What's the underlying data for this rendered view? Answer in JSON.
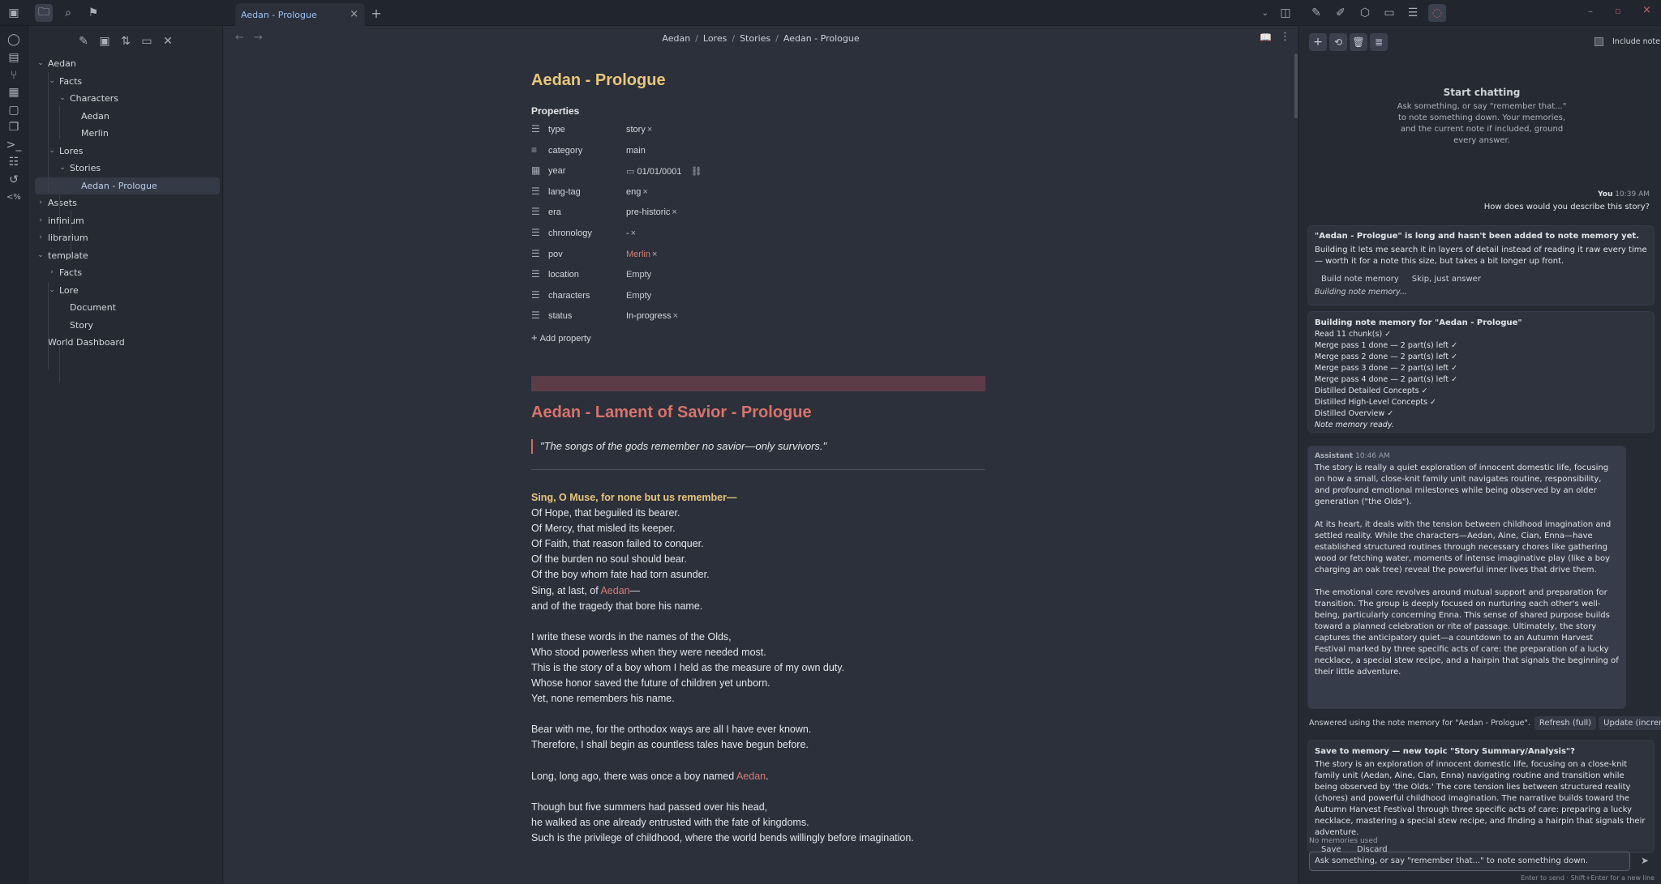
{
  "tab": {
    "title": "Aedan - Prologue"
  },
  "breadcrumb": {
    "parts": [
      "Aedan",
      "Lores",
      "Stories",
      "Aedan - Prologue"
    ],
    "sep": "/"
  },
  "tree": [
    {
      "label": "Aedan",
      "depth": 0,
      "chev": "v"
    },
    {
      "label": "Facts",
      "depth": 1,
      "chev": "v"
    },
    {
      "label": "Characters",
      "depth": 2,
      "chev": "v"
    },
    {
      "label": "Aedan",
      "depth": 3,
      "chev": ""
    },
    {
      "label": "Merlin",
      "depth": 3,
      "chev": ""
    },
    {
      "label": "Lores",
      "depth": 1,
      "chev": "v"
    },
    {
      "label": "Stories",
      "depth": 2,
      "chev": "v"
    },
    {
      "label": "Aedan - Prologue",
      "depth": 3,
      "chev": "",
      "selected": true
    },
    {
      "label": "Assets",
      "depth": 0,
      "chev": ">"
    },
    {
      "label": "infinium",
      "depth": 0,
      "chev": ">"
    },
    {
      "label": "librarium",
      "depth": 0,
      "chev": ">"
    },
    {
      "label": "template",
      "depth": 0,
      "chev": "v"
    },
    {
      "label": "Facts",
      "depth": 1,
      "chev": ">"
    },
    {
      "label": "Lore",
      "depth": 1,
      "chev": "v"
    },
    {
      "label": "Document",
      "depth": 2,
      "chev": ""
    },
    {
      "label": "Story",
      "depth": 2,
      "chev": ""
    },
    {
      "label": "World Dashboard",
      "depth": 0,
      "chev": ""
    }
  ],
  "note": {
    "title": "Aedan - Prologue",
    "properties_heading": "Properties",
    "properties": [
      {
        "key": "type",
        "value": "story",
        "x": true,
        "icon": "list-icon"
      },
      {
        "key": "category",
        "value": "main",
        "x": false,
        "icon": "text-icon"
      },
      {
        "key": "year",
        "value": "01/01/0001",
        "x": false,
        "icon": "calendar-icon",
        "date": true
      },
      {
        "key": "lang-tag",
        "value": "eng",
        "x": true,
        "icon": "list-icon"
      },
      {
        "key": "era",
        "value": "pre-historic",
        "x": true,
        "icon": "list-icon"
      },
      {
        "key": "chronology",
        "value": "-",
        "x": true,
        "icon": "list-icon"
      },
      {
        "key": "pov",
        "value": "Merlin",
        "x": true,
        "icon": "list-icon",
        "link": true
      },
      {
        "key": "location",
        "value": "Empty",
        "x": false,
        "icon": "list-icon",
        "empty": true
      },
      {
        "key": "characters",
        "value": "Empty",
        "x": false,
        "icon": "list-icon",
        "empty": true
      },
      {
        "key": "status",
        "value": "In-progress",
        "x": true,
        "icon": "list-icon"
      }
    ],
    "add_property": "Add property",
    "heading": "Aedan - Lament of Savior - Prologue",
    "quote": "\"The songs of the gods remember no savior—only survivors.\"",
    "poem_lead": "Sing, O Muse, for none but us remember—",
    "lines1": [
      "Of Hope, that beguiled its bearer.",
      "Of Mercy, that misled its keeper.",
      "Of Faith, that reason failed to conquer.",
      "Of the burden no soul should bear.",
      "Of the boy whom fate had torn asunder."
    ],
    "sing_prefix": "Sing, at last, of ",
    "sing_link": "Aedan",
    "sing_suffix": "—",
    "line_tragedy": "and of the tragedy that bore his name.",
    "lines2": [
      "I write these words in the names of the Olds,",
      "Who stood powerless when they were needed most.",
      "This is the story of a boy whom I held as the measure of my own duty.",
      "Whose honor saved the future of children yet unborn.",
      "Yet, none remembers his name."
    ],
    "lines3": [
      "Bear with me, for the orthodox ways are all I have ever known.",
      "Therefore, I shall begin as countless tales have begun before."
    ],
    "long_prefix": "Long, long ago, there was once a boy named ",
    "long_link": "Aedan",
    "long_suffix": ".",
    "lines4": [
      "Though but five summers had passed over his head,",
      "he walked as one already entrusted with the fate of kingdoms.",
      "Such is the privilege of childhood, where the world bends willingly before imagination."
    ]
  },
  "chat": {
    "include_note": "Include note",
    "start_title": "Start chatting",
    "start_desc": "Ask something, or say \"remember that...\" to note something down. Your memories, and the current note if included, ground every answer.",
    "user_name": "You",
    "user_time": "10:39 AM",
    "user_msg": "How does would you describe this story?",
    "notice_title": "\"Aedan - Prologue\" is long and hasn't been added to note memory yet.",
    "notice_body": "Building it lets me search it in layers of detail instead of reading it raw every time — worth it for a note this size, but takes a bit longer up front.",
    "btn_build": "Build note memory",
    "btn_skip": "Skip, just answer",
    "building": "Building note memory...",
    "progress_title": "Building note memory for \"Aedan - Prologue\"",
    "progress": [
      "Read 11 chunk(s) ✓",
      "Merge pass 1 done — 2 part(s) left ✓",
      "Merge pass 2 done — 2 part(s) left ✓",
      "Merge pass 3 done — 2 part(s) left ✓",
      "Merge pass 4 done — 2 part(s) left ✓",
      "Distilled Detailed Concepts ✓",
      "Distilled High-Level Concepts ✓",
      "Distilled Overview ✓"
    ],
    "ready": "Note memory ready.",
    "assistant_name": "Assistant",
    "assistant_time": "10:46 AM",
    "answer_p1": "The story is really a quiet exploration of innocent domestic life, focusing on how a small, close-knit family unit navigates routine, responsibility, and profound emotional milestones while being observed by an older generation (\"the Olds\").",
    "answer_p2": "At its heart, it deals with the tension between childhood imagination and settled reality. While the characters—Aedan, Aine, Cian, Enna—have established structured routines through necessary chores like gathering wood or fetching water, moments of intense imaginative play (like a boy charging an oak tree) reveal the powerful inner lives that drive them.",
    "answer_p3": "The emotional core revolves around mutual support and preparation for transition. The group is deeply focused on nurturing each other's well-being, particularly concerning Enna. This sense of shared purpose builds toward a planned celebration or rite of passage. Ultimately, the story captures the anticipatory quiet—a countdown to an Autumn Harvest Festival marked by three specific acts of care: the preparation of a lucky necklace, a special stew recipe, and a hairpin that signals the beginning of their little adventure.",
    "answered_using": "Answered using the note memory for \"Aedan - Prologue\".",
    "btn_refresh": "Refresh (full)",
    "btn_update": "Update (incremental)",
    "save_title": "Save to memory — new topic \"Story Summary/Analysis\"?",
    "save_body": "The story is an exploration of innocent domestic life, focusing on a close-knit family unit (Aedan, Aine, Cian, Enna) navigating routine and transition while being observed by 'the Olds.' The core tension lies between structured reality (chores) and powerful childhood imagination. The narrative builds toward the Autumn Harvest Festival through three specific acts of care: preparing a lucky necklace, mastering a special stew recipe, and finding a hairpin that signals their adventure.",
    "btn_save": "Save",
    "btn_discard": "Discard",
    "no_memories": "No memories used",
    "input_value": "Ask something, or say \"remember that...\" to note something down.",
    "hint": "Enter to send · Shift+Enter for a new line"
  },
  "colors": {
    "accent": "#e8c67b",
    "link": "#d47f72",
    "heading2": "#d9736b",
    "bg": "#2b303b"
  }
}
